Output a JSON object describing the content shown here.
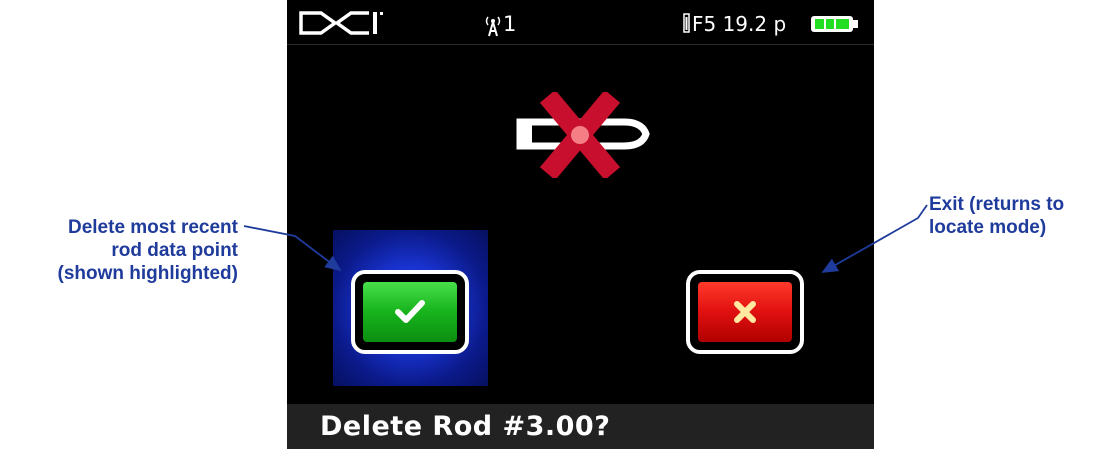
{
  "status_bar": {
    "logo_text": "DCI",
    "signal_icon": "antenna-signal-icon",
    "signal_value": "1",
    "frequency_text": "F5 19.2 p",
    "battery_icon": "battery-full-icon",
    "battery_level": 1.0
  },
  "main": {
    "probe_icon": "transmitter-probe-icon",
    "delete_mark_icon": "red-x-icon",
    "confirm_button_icon": "checkmark-icon",
    "cancel_button_icon": "x-icon",
    "confirm_highlighted": true
  },
  "prompt": {
    "text": "Delete Rod #3.00?"
  },
  "callouts": {
    "left_line1": "Delete most recent",
    "left_line2": "rod data point",
    "left_line3": "(shown highlighted)",
    "right_line1": "Exit (returns to",
    "right_line2": "locate mode)"
  },
  "colors": {
    "callout_text": "#1f3b9c",
    "highlight_blue": "#1a35d6",
    "confirm_green": "#17b31c",
    "cancel_red": "#e01010"
  }
}
